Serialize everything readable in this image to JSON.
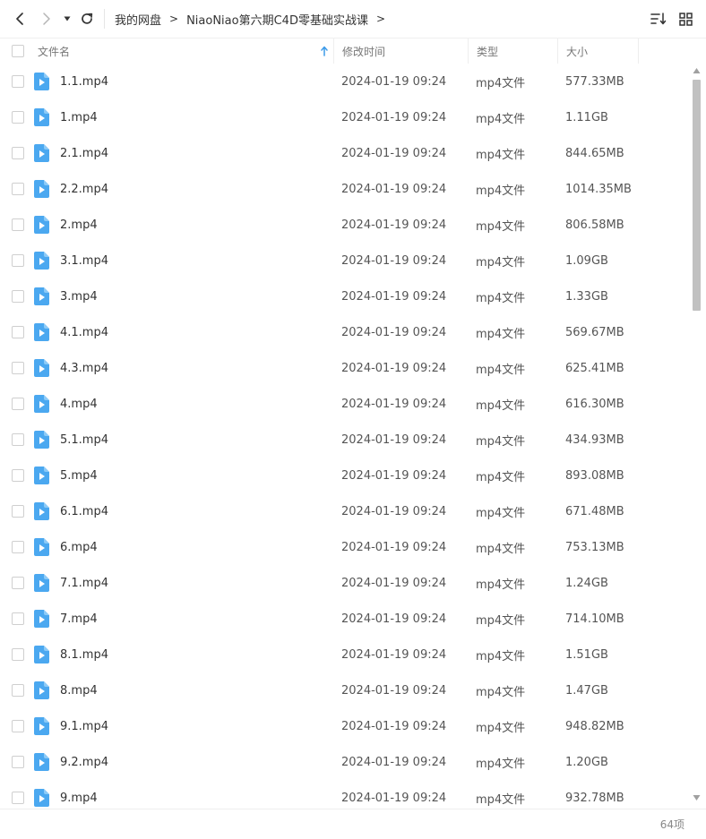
{
  "toolbar": {
    "back_icon": "chevron-left-icon",
    "forward_icon": "chevron-right-icon",
    "history_icon": "caret-down-icon",
    "refresh_icon": "refresh-icon",
    "sort_icon": "sort-icon",
    "view_icon": "grid-view-icon"
  },
  "breadcrumb": {
    "items": [
      "我的网盘",
      "NiaoNiao第六期C4D零基础实战课"
    ],
    "separator": ">"
  },
  "columns": {
    "name": "文件名",
    "date": "修改时间",
    "type": "类型",
    "size": "大小",
    "sorted_by": "name",
    "sort_direction": "ascending"
  },
  "files": [
    {
      "name": "1.1.mp4",
      "date": "2024-01-19 09:24",
      "type": "mp4文件",
      "size": "577.33MB"
    },
    {
      "name": "1.mp4",
      "date": "2024-01-19 09:24",
      "type": "mp4文件",
      "size": "1.11GB"
    },
    {
      "name": "2.1.mp4",
      "date": "2024-01-19 09:24",
      "type": "mp4文件",
      "size": "844.65MB"
    },
    {
      "name": "2.2.mp4",
      "date": "2024-01-19 09:24",
      "type": "mp4文件",
      "size": "1014.35MB"
    },
    {
      "name": "2.mp4",
      "date": "2024-01-19 09:24",
      "type": "mp4文件",
      "size": "806.58MB"
    },
    {
      "name": "3.1.mp4",
      "date": "2024-01-19 09:24",
      "type": "mp4文件",
      "size": "1.09GB"
    },
    {
      "name": "3.mp4",
      "date": "2024-01-19 09:24",
      "type": "mp4文件",
      "size": "1.33GB"
    },
    {
      "name": "4.1.mp4",
      "date": "2024-01-19 09:24",
      "type": "mp4文件",
      "size": "569.67MB"
    },
    {
      "name": "4.3.mp4",
      "date": "2024-01-19 09:24",
      "type": "mp4文件",
      "size": "625.41MB"
    },
    {
      "name": "4.mp4",
      "date": "2024-01-19 09:24",
      "type": "mp4文件",
      "size": "616.30MB"
    },
    {
      "name": "5.1.mp4",
      "date": "2024-01-19 09:24",
      "type": "mp4文件",
      "size": "434.93MB"
    },
    {
      "name": "5.mp4",
      "date": "2024-01-19 09:24",
      "type": "mp4文件",
      "size": "893.08MB"
    },
    {
      "name": "6.1.mp4",
      "date": "2024-01-19 09:24",
      "type": "mp4文件",
      "size": "671.48MB"
    },
    {
      "name": "6.mp4",
      "date": "2024-01-19 09:24",
      "type": "mp4文件",
      "size": "753.13MB"
    },
    {
      "name": "7.1.mp4",
      "date": "2024-01-19 09:24",
      "type": "mp4文件",
      "size": "1.24GB"
    },
    {
      "name": "7.mp4",
      "date": "2024-01-19 09:24",
      "type": "mp4文件",
      "size": "714.10MB"
    },
    {
      "name": "8.1.mp4",
      "date": "2024-01-19 09:24",
      "type": "mp4文件",
      "size": "1.51GB"
    },
    {
      "name": "8.mp4",
      "date": "2024-01-19 09:24",
      "type": "mp4文件",
      "size": "1.47GB"
    },
    {
      "name": "9.1.mp4",
      "date": "2024-01-19 09:24",
      "type": "mp4文件",
      "size": "948.82MB"
    },
    {
      "name": "9.2.mp4",
      "date": "2024-01-19 09:24",
      "type": "mp4文件",
      "size": "1.20GB"
    },
    {
      "name": "9.mp4",
      "date": "2024-01-19 09:24",
      "type": "mp4文件",
      "size": "932.78MB"
    }
  ],
  "file_icon": "video-file-icon",
  "footer": {
    "count": "64项"
  },
  "colors": {
    "accent": "#3d9be9",
    "icon_blue": "#4ba8f0",
    "text": "#333333",
    "muted": "#888888"
  }
}
